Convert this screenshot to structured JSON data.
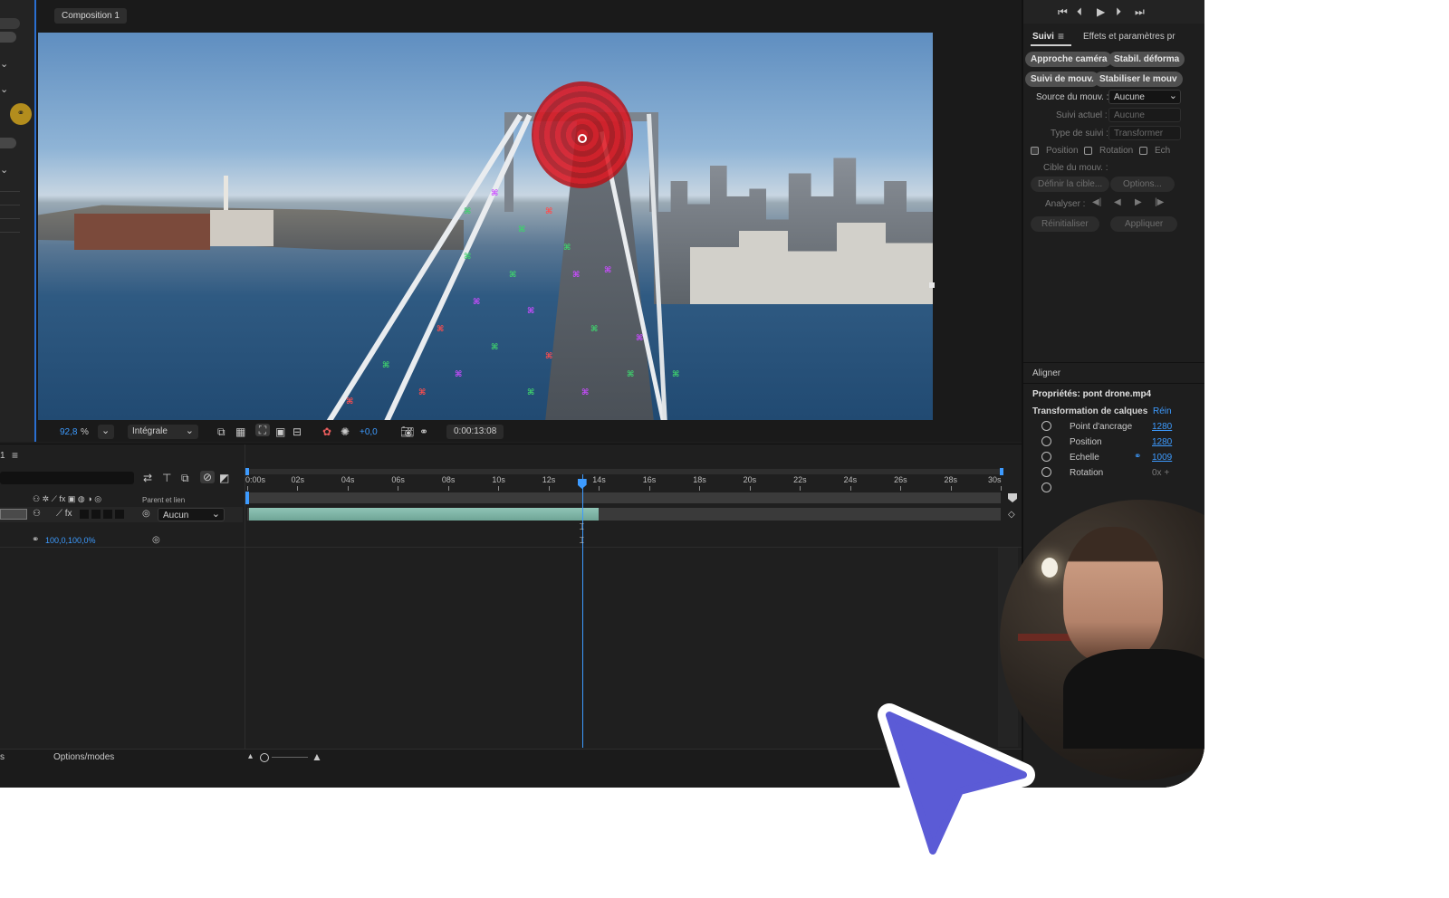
{
  "composition_tab": "Composition 1",
  "viewer": {
    "zoom_value": "92,8",
    "zoom_unit": "%",
    "resolution": "Intégrale",
    "exposure": "+0,0",
    "timecode": "0:00:13:08"
  },
  "timeline": {
    "panel_number": "1",
    "ticks": [
      "0:00s",
      "02s",
      "04s",
      "06s",
      "08s",
      "10s",
      "12s",
      "14s",
      "16s",
      "18s",
      "20s",
      "22s",
      "24s",
      "26s",
      "28s",
      "30s"
    ],
    "parent_header": "Parent et lien",
    "parent_value": "Aucun",
    "scale_value": "100,0,100,0%",
    "bottom_left": "s",
    "options_modes": "Options/modes",
    "playhead_seconds": 13.33,
    "total_seconds": 30,
    "layer_bar_end_seconds": 14
  },
  "tracker": {
    "tab_suivi": "Suivi",
    "tab_effets": "Effets et paramètres pr",
    "btn_approche": "Approche caméra",
    "btn_stabil": "Stabil. déforma",
    "btn_suivi_mouv": "Suivi de mouv.",
    "btn_stabiliser": "Stabiliser le mouv",
    "source_label": "Source du mouv. :",
    "source_value": "Aucune",
    "suivi_actuel_label": "Suivi actuel :",
    "suivi_actuel_value": "Aucune",
    "type_label": "Type de suivi :",
    "type_value": "Transformer",
    "position_label": "Position",
    "rotation_label": "Rotation",
    "echelle_label": "Ech",
    "cible_label": "Cible du mouv. :",
    "definir_btn": "Définir la cible...",
    "options_btn": "Options...",
    "analyser_label": "Analyser :",
    "reinit_btn": "Réinitialiser",
    "appliquer_btn": "Appliquer"
  },
  "properties": {
    "aligner": "Aligner",
    "title": "Propriétés: pont drone.mp4",
    "transform_label": "Transformation de calques",
    "reinit_link": "Réin",
    "rows": [
      {
        "label": "Point d'ancrage",
        "value": "1280"
      },
      {
        "label": "Position",
        "value": "1280"
      },
      {
        "label": "Echelle",
        "value": "1009"
      },
      {
        "label": "Rotation",
        "value": "0x +"
      }
    ]
  },
  "transport": [
    "skip-start-icon",
    "step-back-icon",
    "play-icon",
    "step-forward-icon",
    "skip-end-icon"
  ],
  "colors": {
    "accent_blue": "#3d9bff",
    "cursor": "#5b5bd6",
    "target_red": "#e0141e",
    "layer_bar": "#7eb5a6"
  }
}
